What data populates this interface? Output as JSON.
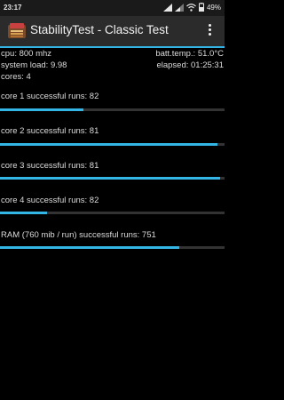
{
  "status_bar": {
    "time": "23:17",
    "battery": "49%"
  },
  "app": {
    "title": "StabilityTest - Classic Test"
  },
  "info": {
    "cpu": "cpu: 800 mhz",
    "batt_temp": "batt.temp.: 51.0°C",
    "system_load": "system load: 9.98",
    "elapsed": "elapsed: 01:25:31",
    "cores": "cores: 4"
  },
  "runs": [
    {
      "label": "core 1 successful runs: 82",
      "progress": 0.37
    },
    {
      "label": "core 2 successful runs: 81",
      "progress": 0.97
    },
    {
      "label": "core 3 successful runs: 81",
      "progress": 0.98
    },
    {
      "label": "core 4 successful runs: 82",
      "progress": 0.21
    },
    {
      "label": "RAM (760 mib / run) successful runs: 751",
      "progress": 0.8
    }
  ],
  "colors": {
    "accent": "#33b5e5",
    "track": "#333333",
    "background": "#000000"
  }
}
